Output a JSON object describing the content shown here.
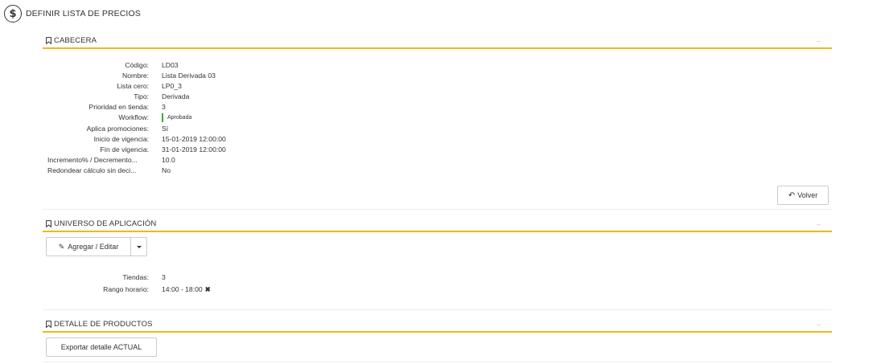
{
  "page": {
    "title": "DEFINIR LISTA DE PRECIOS",
    "icon": "dollar-circle-icon"
  },
  "cabecera": {
    "title": "CABECERA",
    "collapse": "–",
    "fields": [
      {
        "label": "Código:",
        "value": "LD03"
      },
      {
        "label": "Nombre:",
        "value": "Lista Derivada 03"
      },
      {
        "label": "Lista cero:",
        "value": "LP0_3"
      },
      {
        "label": "Tipo:",
        "value": "Derivada"
      },
      {
        "label": "Prioridad en tienda:",
        "value": "3"
      },
      {
        "label": "Workflow:",
        "value": "Aprobada"
      },
      {
        "label": "Aplica promociones:",
        "value": "Sí"
      },
      {
        "label": "Inicio de vigencia:",
        "value": "15-01-2019 12:00:00"
      },
      {
        "label": "Fín de vigencia:",
        "value": "31-01-2019 12:00:00"
      },
      {
        "label": "Incremento% / Decremento...",
        "value": "10.0"
      },
      {
        "label": "Redondear cálculo sin deci...",
        "value": "No"
      }
    ],
    "volver_label": "Volver",
    "workflow_color": "#3aaa35"
  },
  "universo": {
    "title": "UNIVERSO DE APLICACIÓN",
    "collapse": "–",
    "agregar_label": "Agregar / Editar",
    "fields": [
      {
        "label": "Tiendas:",
        "value": "3"
      },
      {
        "label": "Rango horario:",
        "value": "14:00 - 18:00"
      }
    ],
    "remove_symbol": "✖"
  },
  "detalle": {
    "title": "DETALLE DE PRODUCTOS",
    "collapse": "–",
    "export_label": "Exportar detalle ACTUAL"
  },
  "colors": {
    "accent": "#f0b71e",
    "text": "#333333"
  }
}
